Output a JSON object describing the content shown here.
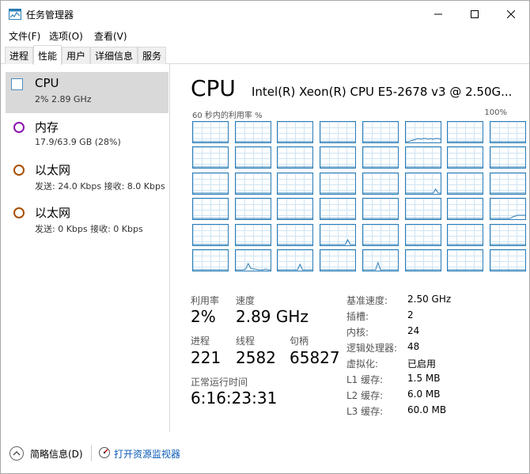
{
  "window": {
    "title": "任务管理器"
  },
  "menu": [
    "文件(F)",
    "选项(O)",
    "查看(V)"
  ],
  "tabs": [
    "进程",
    "性能",
    "用户",
    "详细信息",
    "服务"
  ],
  "active_tab": "性能",
  "resources": [
    {
      "title": "CPU",
      "sub": "2%  2.89 GHz",
      "color": "#2a7cb6",
      "selected": true
    },
    {
      "title": "内存",
      "sub": "17.9/63.9 GB (28%)",
      "color": "#8b12ae"
    },
    {
      "title": "以太网",
      "sub": "发送: 24.0 Kbps  接收: 8.0 Kbps",
      "color": "#a74f01"
    },
    {
      "title": "以太网",
      "sub": "发送: 0 Kbps  接收: 0 Kbps",
      "color": "#a74f01"
    }
  ],
  "detail": {
    "title": "CPU",
    "model": "Intel(R) Xeon(R) CPU E5-2678 v3 @ 2.50G...",
    "graph_left": "60 秒内的利用率 %",
    "graph_right": "100%",
    "util_label": "利用率",
    "util_value": "2%",
    "speed_label": "速度",
    "speed_value": "2.89 GHz",
    "proc_label": "进程",
    "proc_value": "221",
    "thread_label": "线程",
    "thread_value": "2582",
    "handle_label": "句柄",
    "handle_value": "65827",
    "uptime_label": "正常运行时间",
    "uptime_value": "6:16:23:31",
    "specs": [
      {
        "label": "基准速度:",
        "value": "2.50 GHz"
      },
      {
        "label": "插槽:",
        "value": "2"
      },
      {
        "label": "内核:",
        "value": "24"
      },
      {
        "label": "逻辑处理器:",
        "value": "48"
      },
      {
        "label": "虚拟化:",
        "value": "已启用"
      },
      {
        "label": "L1 缓存:",
        "value": "1.5 MB"
      },
      {
        "label": "L2 缓存:",
        "value": "6.0 MB"
      },
      {
        "label": "L3 缓存:",
        "value": "60.0 MB"
      }
    ]
  },
  "footer": {
    "fewer_details": "简略信息(D)",
    "open_monitor": "打开资源监视器"
  }
}
